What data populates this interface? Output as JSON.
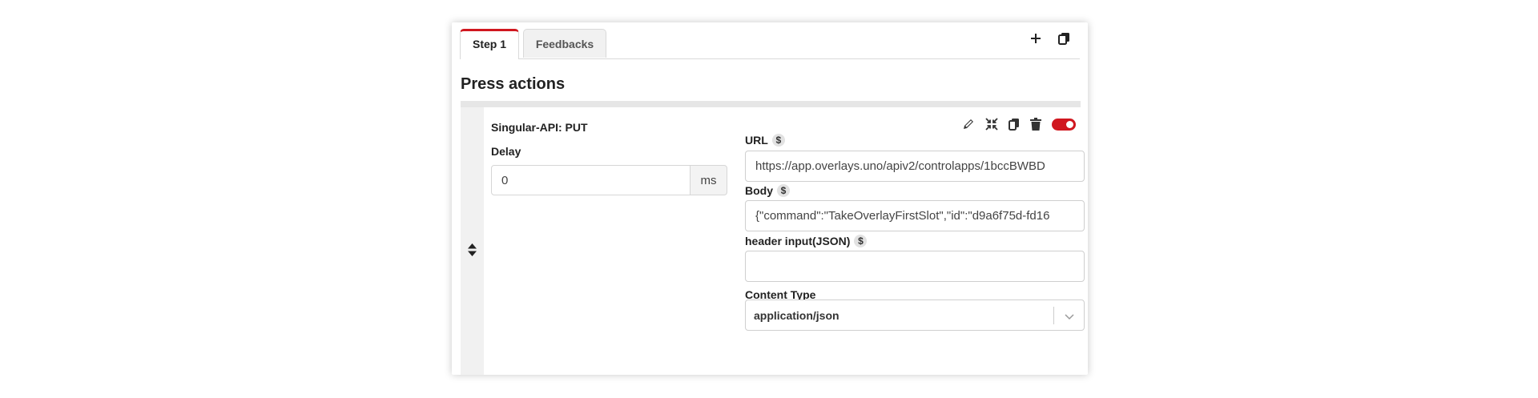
{
  "tabs": [
    {
      "label": "Step 1",
      "active": true
    },
    {
      "label": "Feedbacks",
      "active": false
    }
  ],
  "top_icons": [
    "plus-icon",
    "copy-icon"
  ],
  "section_title": "Press actions",
  "action": {
    "name": "Singular-API: PUT",
    "icons": [
      "pencil-icon",
      "collapse-icon",
      "duplicate-icon",
      "trash-icon"
    ],
    "enabled": true,
    "delay_label": "Delay",
    "delay_value": "0",
    "delay_unit": "ms",
    "url_label": "URL",
    "url_value": "https://app.overlays.uno/apiv2/controlapps/1bccBWBD",
    "body_label": "Body",
    "body_value": "{\"command\":\"TakeOverlayFirstSlot\",\"id\":\"d9a6f75d-fd16",
    "header_label": "header input(JSON)",
    "header_value": "",
    "content_type_label": "Content Type",
    "content_type_value": "application/json",
    "variable_symbol": "$"
  },
  "colors": {
    "accent": "#d0171f",
    "panel_bg": "#f1f1f1"
  }
}
